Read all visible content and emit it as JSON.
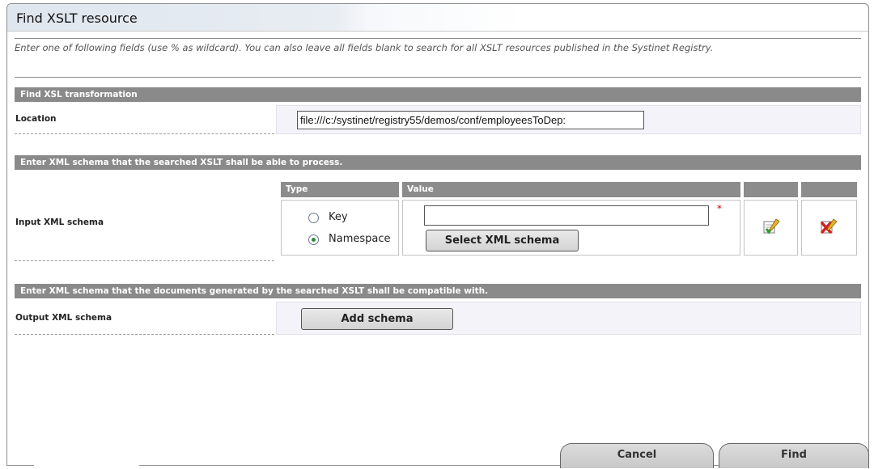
{
  "dialog": {
    "title": "Find XSLT resource",
    "intro": "Enter one of following fields (use % as wildcard). You can also leave all fields blank to search for all XSLT resources published in the Systinet Registry."
  },
  "section_xsl": {
    "header": "Find XSL transformation",
    "location_label": "Location",
    "location_value": "file:///c:/systinet/registry55/demos/conf/employeesToDep:"
  },
  "section_input": {
    "header": "Enter XML schema that the searched XSLT shall be able to process.",
    "row_label": "Input XML schema",
    "col_type": "Type",
    "col_value": "Value",
    "radio_key": "Key",
    "radio_namespace": "Namespace",
    "selected_type": "Namespace",
    "value_input": "",
    "required_mark": "*",
    "select_button": "Select XML schema",
    "icons": [
      "edit-icon",
      "delete-icon"
    ]
  },
  "section_output": {
    "header": "Enter XML schema that the documents generated by the searched XSLT shall be compatible with.",
    "row_label": "Output XML schema",
    "add_button": "Add schema"
  },
  "footer": {
    "cancel": "Cancel",
    "find": "Find"
  }
}
